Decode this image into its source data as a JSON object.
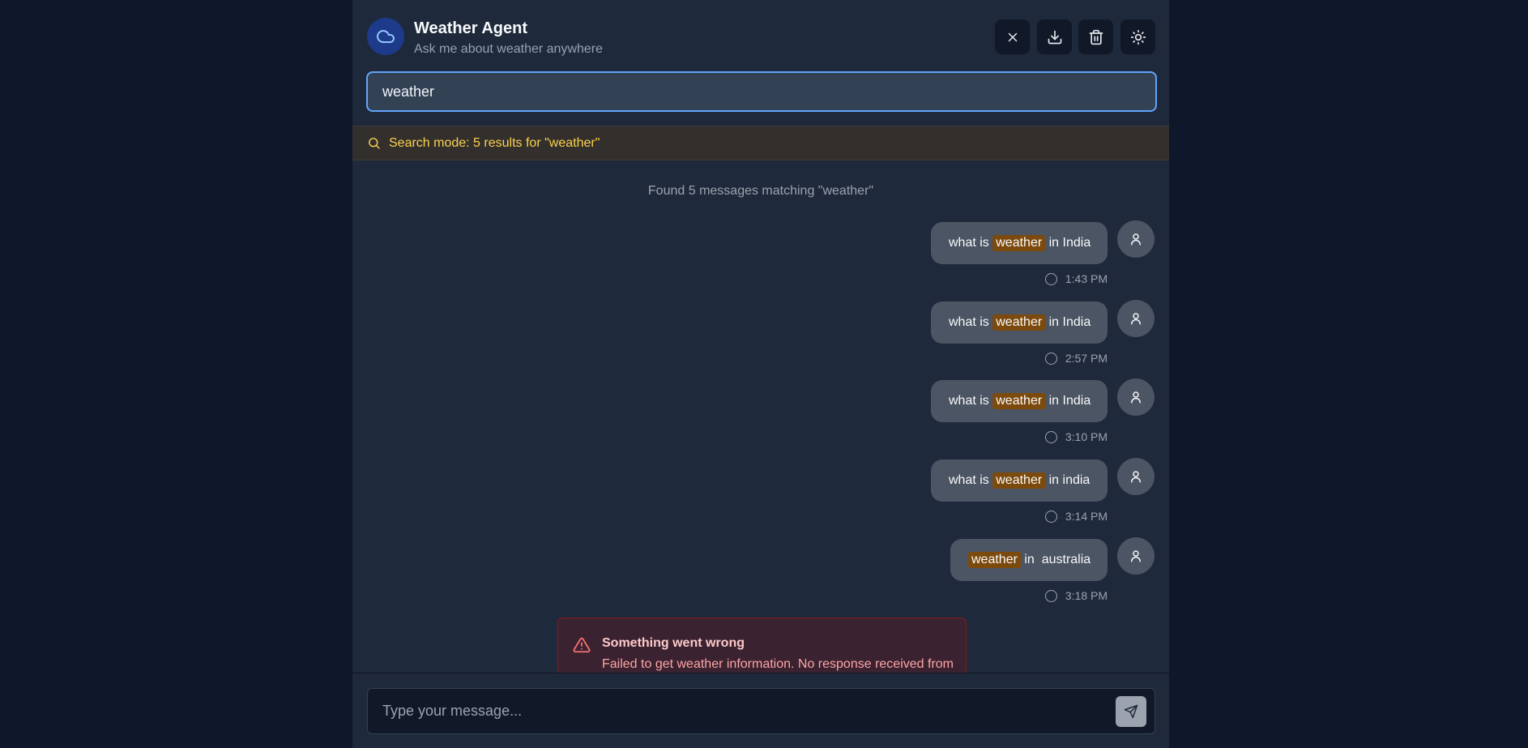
{
  "header": {
    "title": "Weather Agent",
    "subtitle": "Ask me about weather anywhere",
    "logo_icon": "cloud-icon",
    "buttons": [
      {
        "name": "close-search-button",
        "icon": "close-icon"
      },
      {
        "name": "download-button",
        "icon": "download-icon"
      },
      {
        "name": "delete-button",
        "icon": "trash-icon"
      },
      {
        "name": "theme-toggle-button",
        "icon": "sun-icon"
      }
    ]
  },
  "search": {
    "value": "weather"
  },
  "banner": {
    "text": "Search mode: 5 results for \"weather\""
  },
  "results": {
    "summary": "Found 5 messages matching \"weather\""
  },
  "messages": [
    {
      "before": "what is ",
      "match": "weather",
      "after": " in India",
      "time": "1:43 PM"
    },
    {
      "before": "what is ",
      "match": "weather",
      "after": " in India",
      "time": "2:57 PM"
    },
    {
      "before": "what is ",
      "match": "weather",
      "after": " in India",
      "time": "3:10 PM"
    },
    {
      "before": "what is ",
      "match": "weather",
      "after": " in india",
      "time": "3:14 PM"
    },
    {
      "before": "",
      "match": "weather",
      "after": " in  australia",
      "time": "3:18 PM"
    }
  ],
  "error": {
    "title": "Something went wrong",
    "message": "Failed to get weather information. No response received from"
  },
  "composer": {
    "placeholder": "Type your message..."
  },
  "colors": {
    "accent": "#60a5fa",
    "highlight": "#7c4a0d",
    "banner_text": "#fcd34d",
    "error_text": "#fca5a5"
  }
}
